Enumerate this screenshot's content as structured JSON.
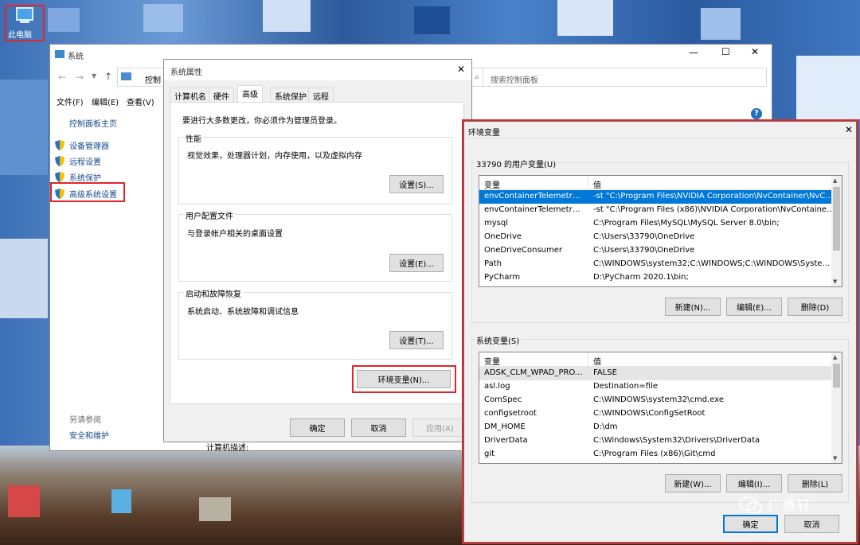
{
  "desktop": {
    "icon_label": "此电脑"
  },
  "system_window": {
    "title": "系统",
    "address": "控制",
    "search_placeholder": "搜索控制面板",
    "menu": [
      "文件(F)",
      "编辑(E)",
      "查看(V)"
    ],
    "home": "控制面板主页",
    "links": [
      "设备管理器",
      "远程设置",
      "系统保护",
      "高级系统设置"
    ],
    "see_also": "另请参阅",
    "security": "安全和维护",
    "partial_text": "计算机描述:"
  },
  "props": {
    "title": "系统属性",
    "tabs": [
      "计算机名",
      "硬件",
      "高级",
      "系统保护",
      "远程"
    ],
    "admin_note": "要进行大多数更改，你必须作为管理员登录。",
    "perf_title": "性能",
    "perf_desc": "视觉效果，处理器计划，内存使用，以及虚拟内存",
    "perf_btn": "设置(S)...",
    "profile_title": "用户配置文件",
    "profile_desc": "与登录帐户相关的桌面设置",
    "profile_btn": "设置(E)...",
    "startup_title": "启动和故障恢复",
    "startup_desc": "系统启动、系统故障和调试信息",
    "startup_btn": "设置(T)...",
    "env_btn": "环境变量(N)...",
    "ok": "确定",
    "cancel": "取消",
    "apply": "应用(A)"
  },
  "env": {
    "title": "环境变量",
    "user_group": "33790 的用户变量(U)",
    "col_var": "变量",
    "col_val": "值",
    "user_vars": [
      {
        "name": "envContainerTelemetryAp...",
        "value": "-st \"C:\\Program Files\\NVIDIA Corporation\\NvContainer\\NvCo..."
      },
      {
        "name": "envContainerTelemetryAp...",
        "value": "-st \"C:\\Program Files (x86)\\NVIDIA Corporation\\NvContainer\\..."
      },
      {
        "name": "mysql",
        "value": "C:\\Program Files\\MySQL\\MySQL Server 8.0\\bin;"
      },
      {
        "name": "OneDrive",
        "value": "C:\\Users\\33790\\OneDrive"
      },
      {
        "name": "OneDriveConsumer",
        "value": "C:\\Users\\33790\\OneDrive"
      },
      {
        "name": "Path",
        "value": "C:\\WINDOWS\\system32;C:\\WINDOWS;C:\\WINDOWS\\System..."
      },
      {
        "name": "PyCharm",
        "value": "D:\\PyCharm 2020.1\\bin;"
      }
    ],
    "user_new": "新建(N)...",
    "user_edit": "编辑(E)...",
    "user_delete": "删除(D)",
    "sys_group": "系统变量(S)",
    "sys_vars": [
      {
        "name": "ADSK_CLM_WPAD_PROXY...",
        "value": "FALSE"
      },
      {
        "name": "asl.log",
        "value": "Destination=file"
      },
      {
        "name": "ComSpec",
        "value": "C:\\WINDOWS\\system32\\cmd.exe"
      },
      {
        "name": "configsetroot",
        "value": "C:\\WINDOWS\\ConfigSetRoot"
      },
      {
        "name": "DM_HOME",
        "value": "D:\\dm"
      },
      {
        "name": "DriverData",
        "value": "C:\\Windows\\System32\\Drivers\\DriverData"
      },
      {
        "name": "git",
        "value": "C:\\Program Files (x86)\\Git\\cmd"
      }
    ],
    "sys_new": "新建(W)...",
    "sys_edit": "编辑(I)...",
    "sys_delete": "删除(L)",
    "ok": "确定",
    "cancel": "取消"
  },
  "watermark": "广勇轩"
}
